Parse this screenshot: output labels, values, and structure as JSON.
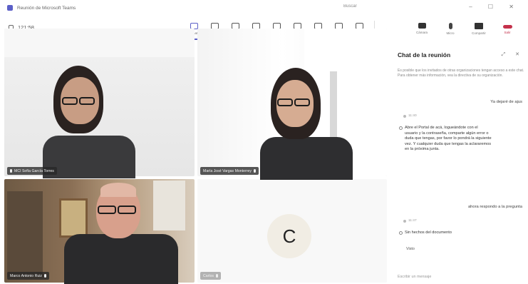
{
  "window": {
    "title": "Reunión de Microsoft Teams",
    "search_placeholder": "Buscar",
    "controls": "–  ☐  ✕"
  },
  "meeting": {
    "timer": "121:58"
  },
  "toolbar": {
    "items": [
      {
        "label": "Chat",
        "icon": "chat-icon"
      },
      {
        "label": "Gente",
        "icon": "people-icon"
      },
      {
        "label": "Rabiscador",
        "icon": "raise-hand-icon"
      },
      {
        "label": "Reacción",
        "icon": "reactions-icon"
      },
      {
        "label": "Vista",
        "icon": "view-icon"
      },
      {
        "label": "Notas",
        "icon": "notes-icon"
      },
      {
        "label": "Grabar",
        "icon": "record-icon"
      },
      {
        "label": "Aplicaciones",
        "icon": "apps-icon"
      },
      {
        "label": "Más",
        "icon": "more-icon"
      }
    ],
    "media": [
      {
        "label": "Cámara",
        "icon": "camera-icon"
      },
      {
        "label": "Micro",
        "icon": "microphone-icon"
      },
      {
        "label": "Compartir",
        "icon": "share-icon"
      },
      {
        "label": "Salir",
        "icon": "leave-icon"
      }
    ]
  },
  "participants": [
    {
      "name": "MCI Sofía García Torres"
    },
    {
      "name": "María José Vargas Monterrey"
    },
    {
      "name": "Marco Antonio Ruiz"
    },
    {
      "name": "Carlos",
      "initial": "C"
    }
  ],
  "chat": {
    "title": "Chat de la reunión",
    "notice": "Es posible que los invitados de otras organizaciones tengan acceso a este chat. Para obtener más información, vea la directiva de su organización.",
    "messages": [
      {
        "type": "sent",
        "text": "Ya dejaré de ajus"
      },
      {
        "type": "received",
        "meta": "11:40",
        "text": "Abre el Portal de acá, logueándote con el usuario y la contraseña, comparte algún error o duda que tengas, por favor lo pondrá la siguiente vez. Y cualquier duda que tengas la aclararemos en la próxima junta."
      },
      {
        "type": "sent",
        "text": "ahora respondo a la pregunta"
      },
      {
        "type": "received",
        "meta": "11:47",
        "text": "Sin hechos del documento"
      }
    ],
    "seen": "Visto",
    "compose_placeholder": "Escribir un mensaje"
  },
  "colors": {
    "accent": "#5b5fc7",
    "leave": "#c4314b"
  }
}
